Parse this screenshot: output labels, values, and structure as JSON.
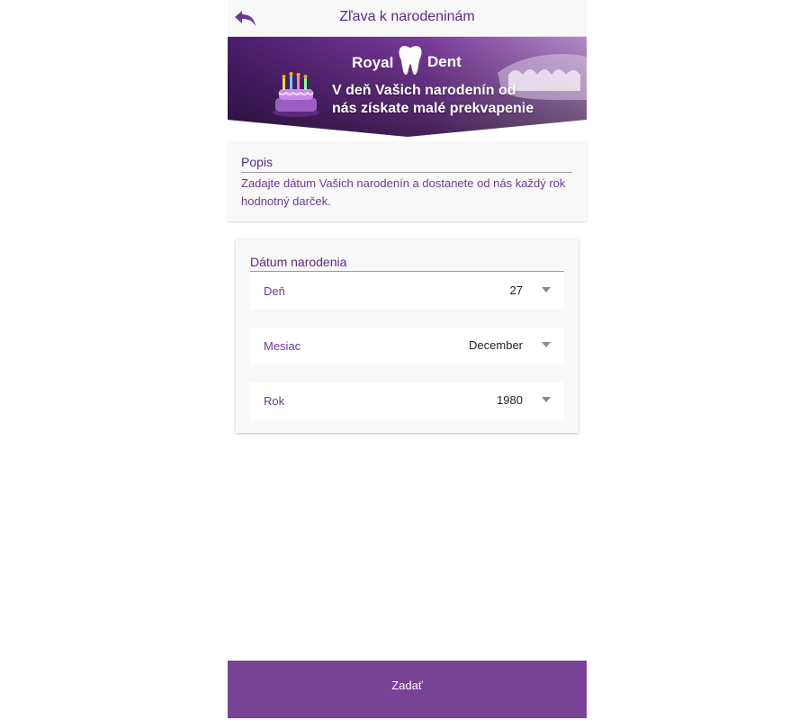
{
  "header": {
    "title": "Zľava k narodeninám"
  },
  "banner": {
    "brand_left": "Royal",
    "brand_right": "Dent",
    "message": "V deň Vašich narodenín od nás získate malé prekvapenie"
  },
  "description": {
    "title": "Popis",
    "text": "Zadajte dátum Vašich narodenín a dostanete od nás každý rok hodnotný darček."
  },
  "birthdate": {
    "title": "Dátum narodenia",
    "fields": [
      {
        "label": "Deň",
        "value": "27"
      },
      {
        "label": "Mesiac",
        "value": "December"
      },
      {
        "label": "Rok",
        "value": "1980"
      }
    ]
  },
  "submit": {
    "label": "Zadať"
  },
  "colors": {
    "accent": "#784295",
    "text_purple": "#5b2a86"
  },
  "icons": {
    "back": "back-arrow-icon",
    "caret": "chevron-down-icon"
  }
}
